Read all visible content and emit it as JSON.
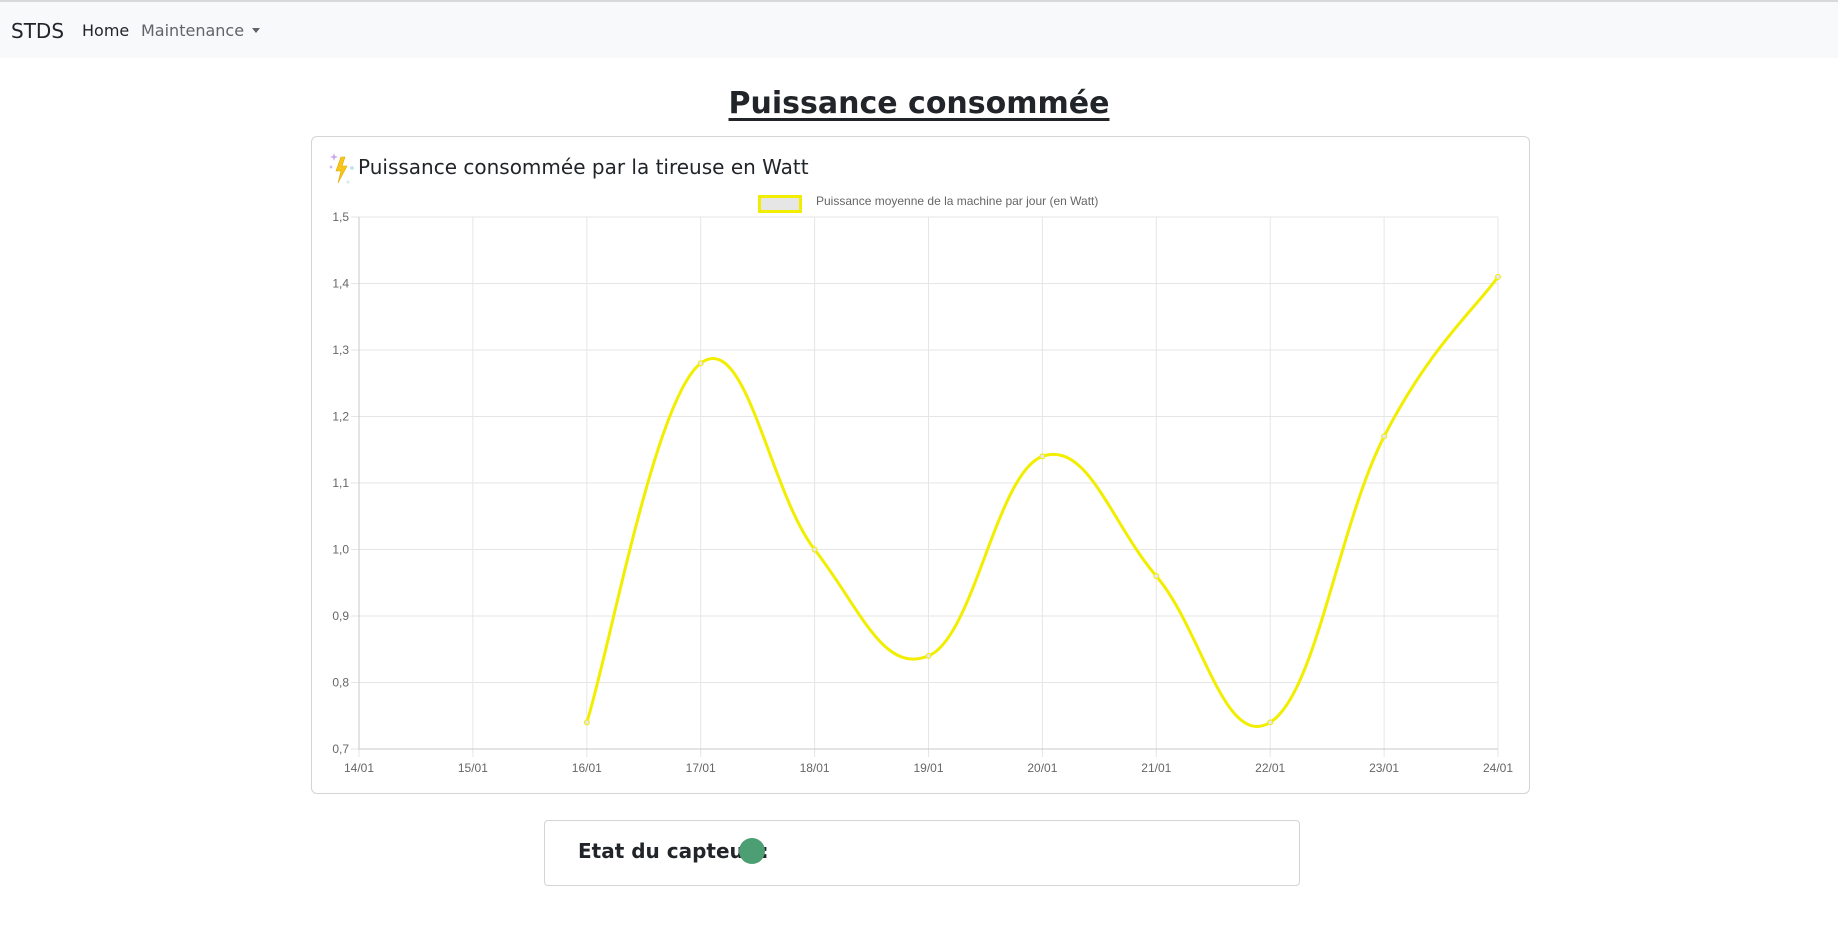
{
  "navbar": {
    "brand": "STDS",
    "home_label": "Home",
    "maintenance_label": "Maintenance"
  },
  "page": {
    "title": "Puissance consommée"
  },
  "chart_card": {
    "title": "Puissance consommée par la tireuse en Watt",
    "icon": "bolt-sparkle-icon"
  },
  "chart_data": {
    "type": "line",
    "title": "",
    "xlabel": "",
    "ylabel": "",
    "x": [
      "14/01",
      "15/01",
      "16/01",
      "17/01",
      "18/01",
      "19/01",
      "20/01",
      "21/01",
      "22/01",
      "23/01",
      "24/01"
    ],
    "series": [
      {
        "name": "Puissance moyenne de la machine par jour (en Watt)",
        "values": [
          null,
          null,
          0.74,
          1.28,
          1.0,
          0.84,
          1.14,
          0.96,
          0.74,
          1.17,
          1.41
        ],
        "color": "#f2ee00"
      }
    ],
    "ylim": [
      0.7,
      1.5
    ],
    "yticks": [
      "0,7",
      "0,8",
      "0,9",
      "1,0",
      "1,1",
      "1,2",
      "1,3",
      "1,4",
      "1,5"
    ],
    "grid": true,
    "legend": "top-center",
    "smooth": true
  },
  "sensor": {
    "label": "Etat du capteur :",
    "status_color": "#4c9e73"
  }
}
